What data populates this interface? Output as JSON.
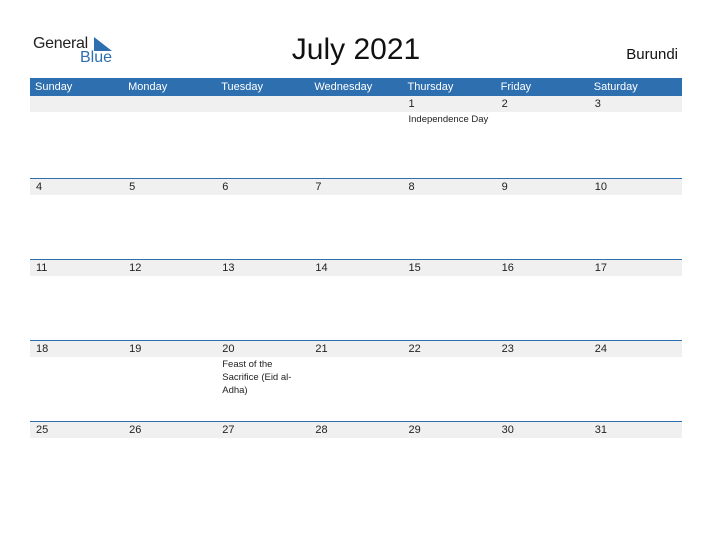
{
  "logo": {
    "general": "General",
    "blue": "Blue"
  },
  "title": "July 2021",
  "country": "Burundi",
  "colors": {
    "accent": "#2e6fb0",
    "strip": "#f0f0f0"
  },
  "weekdays": [
    "Sunday",
    "Monday",
    "Tuesday",
    "Wednesday",
    "Thursday",
    "Friday",
    "Saturday"
  ],
  "weeks": [
    [
      {
        "d": "",
        "e": ""
      },
      {
        "d": "",
        "e": ""
      },
      {
        "d": "",
        "e": ""
      },
      {
        "d": "",
        "e": ""
      },
      {
        "d": "1",
        "e": "Independence Day"
      },
      {
        "d": "2",
        "e": ""
      },
      {
        "d": "3",
        "e": ""
      }
    ],
    [
      {
        "d": "4",
        "e": ""
      },
      {
        "d": "5",
        "e": ""
      },
      {
        "d": "6",
        "e": ""
      },
      {
        "d": "7",
        "e": ""
      },
      {
        "d": "8",
        "e": ""
      },
      {
        "d": "9",
        "e": ""
      },
      {
        "d": "10",
        "e": ""
      }
    ],
    [
      {
        "d": "11",
        "e": ""
      },
      {
        "d": "12",
        "e": ""
      },
      {
        "d": "13",
        "e": ""
      },
      {
        "d": "14",
        "e": ""
      },
      {
        "d": "15",
        "e": ""
      },
      {
        "d": "16",
        "e": ""
      },
      {
        "d": "17",
        "e": ""
      }
    ],
    [
      {
        "d": "18",
        "e": ""
      },
      {
        "d": "19",
        "e": ""
      },
      {
        "d": "20",
        "e": "Feast of the Sacrifice (Eid al-Adha)"
      },
      {
        "d": "21",
        "e": ""
      },
      {
        "d": "22",
        "e": ""
      },
      {
        "d": "23",
        "e": ""
      },
      {
        "d": "24",
        "e": ""
      }
    ],
    [
      {
        "d": "25",
        "e": ""
      },
      {
        "d": "26",
        "e": ""
      },
      {
        "d": "27",
        "e": ""
      },
      {
        "d": "28",
        "e": ""
      },
      {
        "d": "29",
        "e": ""
      },
      {
        "d": "30",
        "e": ""
      },
      {
        "d": "31",
        "e": ""
      }
    ]
  ]
}
